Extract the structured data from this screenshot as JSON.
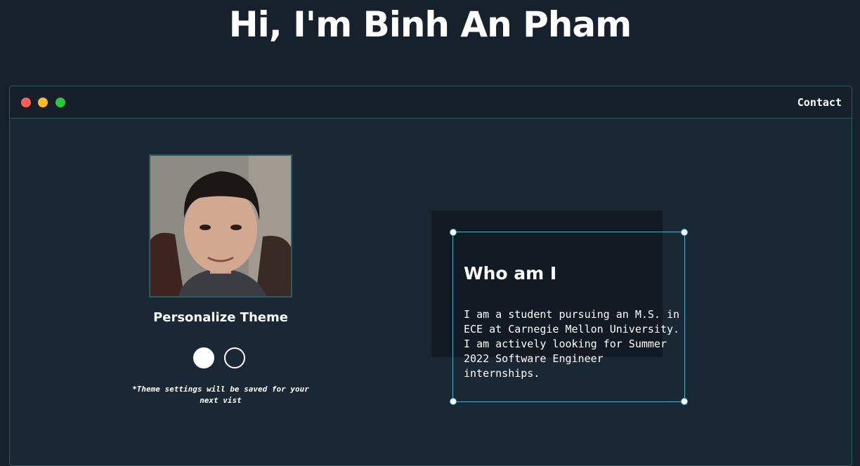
{
  "header": {
    "title": "Hi, I'm Binh An Pham"
  },
  "window": {
    "controls": [
      "close",
      "minimize",
      "maximize"
    ],
    "nav": {
      "contact_label": "Contact"
    }
  },
  "profile": {
    "photo_alt": "Profile photo",
    "theme_title": "Personalize Theme",
    "theme_options": [
      "light",
      "dark"
    ],
    "theme_note": "*Theme settings will be saved for your next vist"
  },
  "about": {
    "title": "Who am I",
    "text": "I am a student pursuing an M.S. in ECE at Carnegie Mellon University. I am actively looking for Summer 2022 Software Engineer internships."
  },
  "colors": {
    "background": "#17212c",
    "window_border": "#2b5a60",
    "accent": "#4eb0c8",
    "close": "#ff5f57",
    "minimize": "#febc2e",
    "maximize": "#28c840"
  }
}
